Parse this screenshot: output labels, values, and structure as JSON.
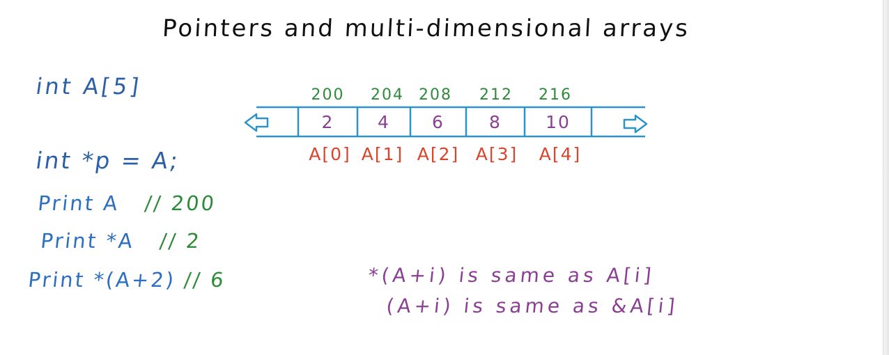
{
  "title": "Pointers and multi-dimensional arrays",
  "declaration": "int A[5]",
  "pointer_assignment": "int *p = A;",
  "prints": [
    {
      "command": "Print A",
      "comment": "// 200"
    },
    {
      "command": "Print *A",
      "comment": "// 2"
    },
    {
      "command": "Print *(A+2)",
      "comment": "// 6"
    }
  ],
  "array": {
    "addresses": [
      "200",
      "204",
      "208",
      "212",
      "216"
    ],
    "values": [
      "2",
      "4",
      "6",
      "8",
      "10"
    ],
    "labels": [
      "A[0]",
      "A[1]",
      "A[2]",
      "A[3]",
      "A[4]"
    ],
    "left_arrow": "arrow-left-icon",
    "right_arrow": "arrow-right-icon"
  },
  "notes": [
    "*(A+i) is same as A[i]",
    "(A+i) is same as &A[i]"
  ],
  "colors": {
    "title": "#111111",
    "code": "#2b5fa8",
    "print": "#2b6fc0",
    "comment": "#2e8b3a",
    "address": "#2e8b3a",
    "index_label": "#d9452b",
    "array_border": "#2b93c9",
    "array_value": "#8a3f93",
    "note": "#8a3f93"
  }
}
